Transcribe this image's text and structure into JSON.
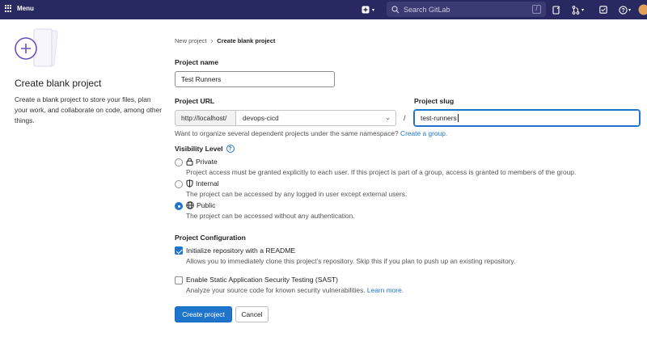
{
  "topbar": {
    "menu_label": "Menu",
    "search_placeholder": "Search GitLab",
    "search_shortcut": "/",
    "icons": [
      "plus-square-icon",
      "search-icon",
      "issues-icon",
      "merge-request-icon",
      "todo-icon",
      "help-icon",
      "avatar"
    ]
  },
  "left": {
    "title": "Create blank project",
    "description": "Create a blank project to store your files, plan your work, and collaborate on code, among other things."
  },
  "breadcrumb": {
    "items": [
      "New project",
      "Create blank project"
    ]
  },
  "form": {
    "project_name_label": "Project name",
    "project_name_value": "Test Runners",
    "project_url_label": "Project URL",
    "url_prefix": "http://localhost/",
    "namespace_value": "devops-cicd",
    "slug_separator": "/",
    "project_slug_label": "Project slug",
    "project_slug_value": "test-runners",
    "namespace_hint": "Want to organize several dependent projects under the same namespace?",
    "create_group_link": "Create a group.",
    "visibility_label": "Visibility Level",
    "visibility": [
      {
        "title": "Private",
        "desc": "Project access must be granted explicitly to each user. If this project is part of a group, access is granted to members of the group.",
        "selected": false
      },
      {
        "title": "Internal",
        "desc": "The project can be accessed by any logged in user except external users.",
        "selected": false
      },
      {
        "title": "Public",
        "desc": "The project can be accessed without any authentication.",
        "selected": true
      }
    ],
    "config_label": "Project Configuration",
    "readme": {
      "label": "Initialize repository with a README",
      "desc": "Allows you to immediately clone this project’s repository. Skip this if you plan to push up an existing repository.",
      "checked": true
    },
    "sast": {
      "label": "Enable Static Application Security Testing (SAST)",
      "desc": "Analyze your source code for known security vulnerabilities.",
      "link": "Learn more.",
      "checked": false
    },
    "create_button": "Create project",
    "cancel_button": "Cancel"
  },
  "colors": {
    "topbar": "#292961",
    "accent": "#1f75cb",
    "illustration": "#6b4fbb"
  }
}
